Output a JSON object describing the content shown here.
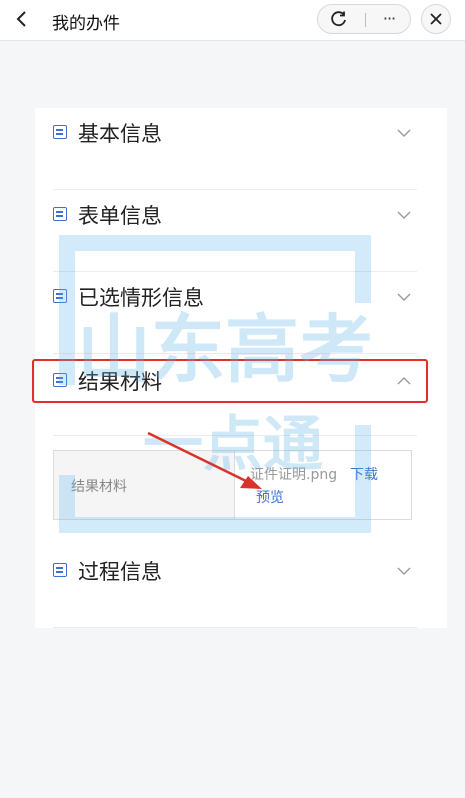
{
  "nav": {
    "title": "我的办件",
    "back_icon": "chevron-left-icon",
    "refresh_icon": "refresh-icon",
    "more_icon": "more-icon",
    "more_glyph": "···",
    "close_icon": "close-icon"
  },
  "sections": [
    {
      "title": "基本信息",
      "expanded": false
    },
    {
      "title": "表单信息",
      "expanded": false
    },
    {
      "title": "已选情形信息",
      "expanded": false
    },
    {
      "title": "结果材料",
      "expanded": true
    },
    {
      "title": "过程信息",
      "expanded": false
    }
  ],
  "materials": {
    "label": "结果材料",
    "file_name": "证件证明.png",
    "download_label": "下载",
    "preview_label": "预览"
  },
  "watermark": {
    "text_line1": "山东高考",
    "text_line2": "一点通"
  },
  "colors": {
    "accent": "#3d6fd6",
    "highlight": "#e0302a",
    "watermark": "#5fb3e8"
  }
}
